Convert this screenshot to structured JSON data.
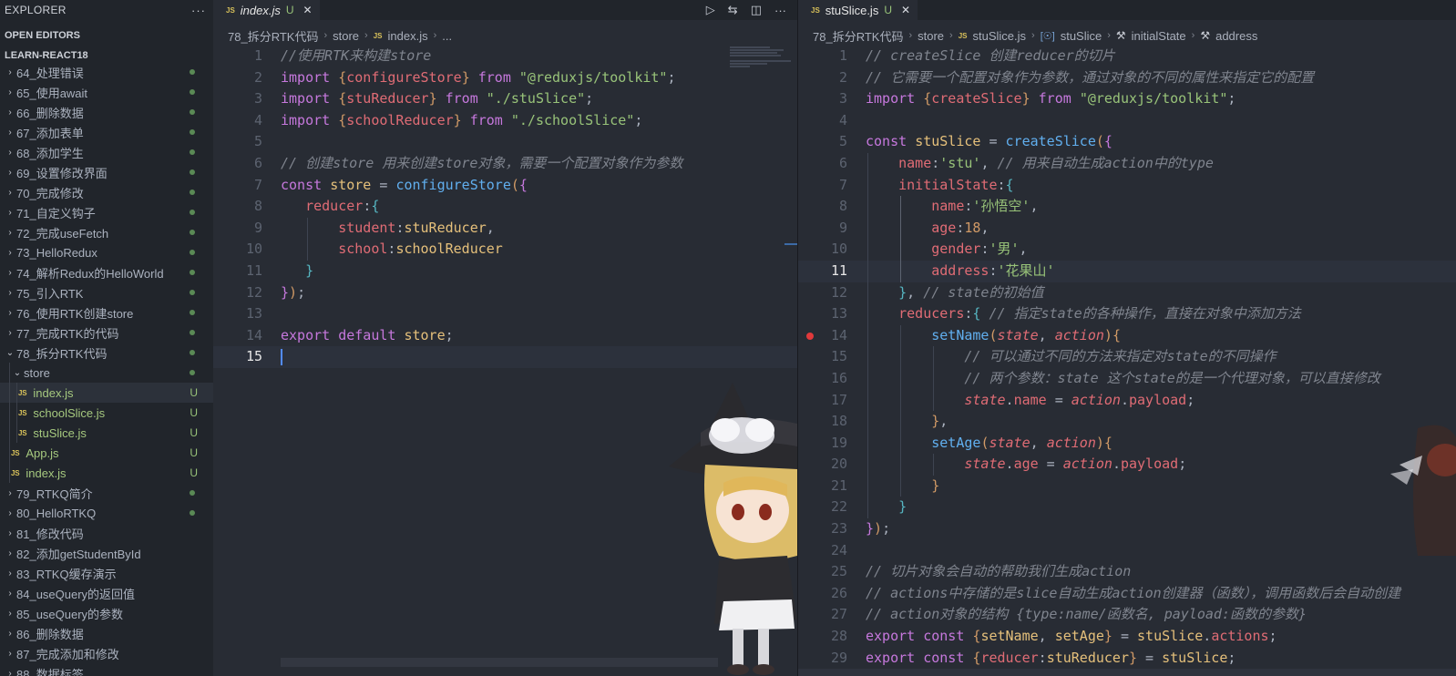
{
  "sidebar": {
    "title": "EXPLORER",
    "more": "···",
    "open_editors": "OPEN EDITORS",
    "workspace": "LEARN-REACT18",
    "items": [
      {
        "label": "64_处理错误",
        "chev": "›",
        "indent": 0,
        "status": "dot"
      },
      {
        "label": "65_使用await",
        "chev": "›",
        "indent": 0,
        "status": "dot"
      },
      {
        "label": "66_删除数据",
        "chev": "›",
        "indent": 0,
        "status": "dot"
      },
      {
        "label": "67_添加表单",
        "chev": "›",
        "indent": 0,
        "status": "dot"
      },
      {
        "label": "68_添加学生",
        "chev": "›",
        "indent": 0,
        "status": "dot"
      },
      {
        "label": "69_设置修改界面",
        "chev": "›",
        "indent": 0,
        "status": "dot"
      },
      {
        "label": "70_完成修改",
        "chev": "›",
        "indent": 0,
        "status": "dot"
      },
      {
        "label": "71_自定义钩子",
        "chev": "›",
        "indent": 0,
        "status": "dot"
      },
      {
        "label": "72_完成useFetch",
        "chev": "›",
        "indent": 0,
        "status": "dot"
      },
      {
        "label": "73_HelloRedux",
        "chev": "›",
        "indent": 0,
        "status": "dot"
      },
      {
        "label": "74_解析Redux的HelloWorld",
        "chev": "›",
        "indent": 0,
        "status": "dot"
      },
      {
        "label": "75_引入RTK",
        "chev": "›",
        "indent": 0,
        "status": "dot"
      },
      {
        "label": "76_使用RTK创建store",
        "chev": "›",
        "indent": 0,
        "status": "dot"
      },
      {
        "label": "77_完成RTK的代码",
        "chev": "›",
        "indent": 0,
        "status": "dot"
      },
      {
        "label": "78_拆分RTK代码",
        "chev": "⌄",
        "indent": 0,
        "status": "dot"
      },
      {
        "label": "store",
        "chev": "⌄",
        "indent": 1,
        "status": "dot"
      },
      {
        "label": "index.js",
        "file": "JS",
        "indent": 2,
        "status": "U",
        "active": true
      },
      {
        "label": "schoolSlice.js",
        "file": "JS",
        "indent": 2,
        "status": "U"
      },
      {
        "label": "stuSlice.js",
        "file": "JS",
        "indent": 2,
        "status": "U"
      },
      {
        "label": "App.js",
        "file": "JS",
        "indent": 1,
        "status": "U"
      },
      {
        "label": "index.js",
        "file": "JS",
        "indent": 1,
        "status": "U"
      },
      {
        "label": "79_RTKQ简介",
        "chev": "›",
        "indent": 0,
        "status": "dot"
      },
      {
        "label": "80_HelloRTKQ",
        "chev": "›",
        "indent": 0,
        "status": "dot"
      },
      {
        "label": "81_修改代码",
        "chev": "›",
        "indent": 0,
        "status": ""
      },
      {
        "label": "82_添加getStudentById",
        "chev": "›",
        "indent": 0,
        "status": ""
      },
      {
        "label": "83_RTKQ缓存演示",
        "chev": "›",
        "indent": 0,
        "status": ""
      },
      {
        "label": "84_useQuery的返回值",
        "chev": "›",
        "indent": 0,
        "status": ""
      },
      {
        "label": "85_useQuery的参数",
        "chev": "›",
        "indent": 0,
        "status": ""
      },
      {
        "label": "86_删除数据",
        "chev": "›",
        "indent": 0,
        "status": ""
      },
      {
        "label": "87_完成添加和修改",
        "chev": "›",
        "indent": 0,
        "status": ""
      },
      {
        "label": "88_数据标签",
        "chev": "›",
        "indent": 0,
        "status": ""
      }
    ]
  },
  "left_editor": {
    "tab": {
      "icon": "JS",
      "name": "index.js",
      "modified": "U",
      "close": "✕"
    },
    "actions": {
      "run": "▷",
      "compare": "⇆",
      "split": "◫",
      "more": "···"
    },
    "breadcrumbs": {
      "folder": "78_拆分RTK代码",
      "sub": "store",
      "file": "index.js",
      "tail": "..."
    },
    "current_line": 15,
    "lines": [
      [
        [
          "c",
          "//使用RTK来构建store"
        ]
      ],
      [
        [
          "k",
          "import "
        ],
        [
          "b1",
          "{"
        ],
        [
          "p",
          "configureStore"
        ],
        [
          "b1",
          "}"
        ],
        [
          "k",
          " from "
        ],
        [
          "s",
          "\"@reduxjs/toolkit\""
        ],
        [
          "t",
          ";"
        ]
      ],
      [
        [
          "k",
          "import "
        ],
        [
          "b1",
          "{"
        ],
        [
          "p",
          "stuReducer"
        ],
        [
          "b1",
          "}"
        ],
        [
          "k",
          " from "
        ],
        [
          "s",
          "\"./stuSlice\""
        ],
        [
          "t",
          ";"
        ]
      ],
      [
        [
          "k",
          "import "
        ],
        [
          "b1",
          "{"
        ],
        [
          "p",
          "schoolReducer"
        ],
        [
          "b1",
          "}"
        ],
        [
          "k",
          " from "
        ],
        [
          "s",
          "\"./schoolSlice\""
        ],
        [
          "t",
          ";"
        ]
      ],
      [],
      [
        [
          "c",
          "// 创建store 用来创建store对象，需要一个配置对象作为参数"
        ]
      ],
      [
        [
          "k",
          "const "
        ],
        [
          "v",
          "store"
        ],
        [
          "t",
          " = "
        ],
        [
          "f",
          "configureStore"
        ],
        [
          "b1",
          "("
        ],
        [
          "b2",
          "{"
        ]
      ],
      [
        [
          "t",
          "   "
        ],
        [
          "p",
          "reducer"
        ],
        [
          "t",
          ":"
        ],
        [
          "b3",
          "{"
        ]
      ],
      [
        [
          "t",
          "       "
        ],
        [
          "p",
          "student"
        ],
        [
          "t",
          ":"
        ],
        [
          "v",
          "stuReducer"
        ],
        [
          "t",
          ","
        ]
      ],
      [
        [
          "t",
          "       "
        ],
        [
          "p",
          "school"
        ],
        [
          "t",
          ":"
        ],
        [
          "v",
          "schoolReducer"
        ]
      ],
      [
        [
          "t",
          "   "
        ],
        [
          "b3",
          "}"
        ]
      ],
      [
        [
          "b2",
          "}"
        ],
        [
          "b1",
          ")"
        ],
        [
          "t",
          ";"
        ]
      ],
      [],
      [
        [
          "k",
          "export default "
        ],
        [
          "v",
          "store"
        ],
        [
          "t",
          ";"
        ]
      ],
      [
        [
          "cursor",
          ""
        ]
      ]
    ]
  },
  "right_editor": {
    "tab": {
      "icon": "JS",
      "name": "stuSlice.js",
      "modified": "U",
      "close": "✕"
    },
    "breadcrumbs": {
      "folder": "78_拆分RTK代码",
      "sub": "store",
      "file": "stuSlice.js",
      "symbol": "stuSlice",
      "prop1": "initialState",
      "prop2": "address"
    },
    "current_line": 11,
    "breakpoint_line": 14,
    "lines": [
      [
        [
          "c",
          "// createSlice 创建reducer的切片"
        ]
      ],
      [
        [
          "c",
          "// 它需要一个配置对象作为参数，通过对象的不同的属性来指定它的配置"
        ]
      ],
      [
        [
          "k",
          "import "
        ],
        [
          "b1",
          "{"
        ],
        [
          "p",
          "createSlice"
        ],
        [
          "b1",
          "}"
        ],
        [
          "k",
          " from "
        ],
        [
          "s",
          "\"@reduxjs/toolkit\""
        ],
        [
          "t",
          ";"
        ]
      ],
      [],
      [
        [
          "k",
          "const "
        ],
        [
          "v",
          "stuSlice"
        ],
        [
          "t",
          " = "
        ],
        [
          "f",
          "createSlice"
        ],
        [
          "b1",
          "("
        ],
        [
          "b2",
          "{"
        ]
      ],
      [
        [
          "t",
          "    "
        ],
        [
          "p",
          "name"
        ],
        [
          "t",
          ":"
        ],
        [
          "s",
          "'stu'"
        ],
        [
          "t",
          ", "
        ],
        [
          "c",
          "// 用来自动生成action中的type"
        ]
      ],
      [
        [
          "t",
          "    "
        ],
        [
          "p",
          "initialState"
        ],
        [
          "t",
          ":"
        ],
        [
          "b3",
          "{"
        ]
      ],
      [
        [
          "t",
          "        "
        ],
        [
          "p",
          "name"
        ],
        [
          "t",
          ":"
        ],
        [
          "s",
          "'孙悟空'"
        ],
        [
          "t",
          ","
        ]
      ],
      [
        [
          "t",
          "        "
        ],
        [
          "p",
          "age"
        ],
        [
          "t",
          ":"
        ],
        [
          "n",
          "18"
        ],
        [
          "t",
          ","
        ]
      ],
      [
        [
          "t",
          "        "
        ],
        [
          "p",
          "gender"
        ],
        [
          "t",
          ":"
        ],
        [
          "s",
          "'男'"
        ],
        [
          "t",
          ","
        ]
      ],
      [
        [
          "t",
          "        "
        ],
        [
          "p",
          "address"
        ],
        [
          "t",
          ":"
        ],
        [
          "s",
          "'花果山'"
        ]
      ],
      [
        [
          "t",
          "    "
        ],
        [
          "b3",
          "}"
        ],
        [
          "t",
          ", "
        ],
        [
          "c",
          "// state的初始值"
        ]
      ],
      [
        [
          "t",
          "    "
        ],
        [
          "p",
          "reducers"
        ],
        [
          "t",
          ":"
        ],
        [
          "b3",
          "{"
        ],
        [
          "t",
          " "
        ],
        [
          "c",
          "// 指定state的各种操作，直接在对象中添加方法"
        ]
      ],
      [
        [
          "t",
          "        "
        ],
        [
          "f",
          "setName"
        ],
        [
          "b1",
          "("
        ],
        [
          "pa",
          "state"
        ],
        [
          "t",
          ", "
        ],
        [
          "pa",
          "action"
        ],
        [
          "b1",
          ")"
        ],
        [
          "b1",
          "{"
        ]
      ],
      [
        [
          "t",
          "            "
        ],
        [
          "c",
          "// 可以通过不同的方法来指定对state的不同操作"
        ]
      ],
      [
        [
          "t",
          "            "
        ],
        [
          "c",
          "// 两个参数：state 这个state的是一个代理对象，可以直接修改"
        ]
      ],
      [
        [
          "t",
          "            "
        ],
        [
          "pa",
          "state"
        ],
        [
          "t",
          "."
        ],
        [
          "p",
          "name"
        ],
        [
          "t",
          " = "
        ],
        [
          "pa",
          "action"
        ],
        [
          "t",
          "."
        ],
        [
          "p",
          "payload"
        ],
        [
          "t",
          ";"
        ]
      ],
      [
        [
          "t",
          "        "
        ],
        [
          "b1",
          "}"
        ],
        [
          "t",
          ","
        ]
      ],
      [
        [
          "t",
          "        "
        ],
        [
          "f",
          "setAge"
        ],
        [
          "b1",
          "("
        ],
        [
          "pa",
          "state"
        ],
        [
          "t",
          ", "
        ],
        [
          "pa",
          "action"
        ],
        [
          "b1",
          ")"
        ],
        [
          "b1",
          "{"
        ]
      ],
      [
        [
          "t",
          "            "
        ],
        [
          "pa",
          "state"
        ],
        [
          "t",
          "."
        ],
        [
          "p",
          "age"
        ],
        [
          "t",
          " = "
        ],
        [
          "pa",
          "action"
        ],
        [
          "t",
          "."
        ],
        [
          "p",
          "payload"
        ],
        [
          "t",
          ";"
        ]
      ],
      [
        [
          "t",
          "        "
        ],
        [
          "b1",
          "}"
        ]
      ],
      [
        [
          "t",
          "    "
        ],
        [
          "b3",
          "}"
        ]
      ],
      [
        [
          "b2",
          "}"
        ],
        [
          "b1",
          ")"
        ],
        [
          "t",
          ";"
        ]
      ],
      [],
      [
        [
          "c",
          "// 切片对象会自动的帮助我们生成action"
        ]
      ],
      [
        [
          "c",
          "// actions中存储的是slice自动生成action创建器（函数），调用函数后会自动创建"
        ]
      ],
      [
        [
          "c",
          "// action对象的结构 {type:name/函数名, payload:函数的参数}"
        ]
      ],
      [
        [
          "k",
          "export const "
        ],
        [
          "b1",
          "{"
        ],
        [
          "v",
          "setName"
        ],
        [
          "t",
          ", "
        ],
        [
          "v",
          "setAge"
        ],
        [
          "b1",
          "}"
        ],
        [
          "t",
          " = "
        ],
        [
          "v",
          "stuSlice"
        ],
        [
          "t",
          "."
        ],
        [
          "p",
          "actions"
        ],
        [
          "t",
          ";"
        ]
      ],
      [
        [
          "k",
          "export const "
        ],
        [
          "b1",
          "{"
        ],
        [
          "p",
          "reducer"
        ],
        [
          "t",
          ":"
        ],
        [
          "v",
          "stuReducer"
        ],
        [
          "b1",
          "}"
        ],
        [
          "t",
          " = "
        ],
        [
          "v",
          "stuSlice"
        ],
        [
          "t",
          ";"
        ]
      ]
    ]
  }
}
